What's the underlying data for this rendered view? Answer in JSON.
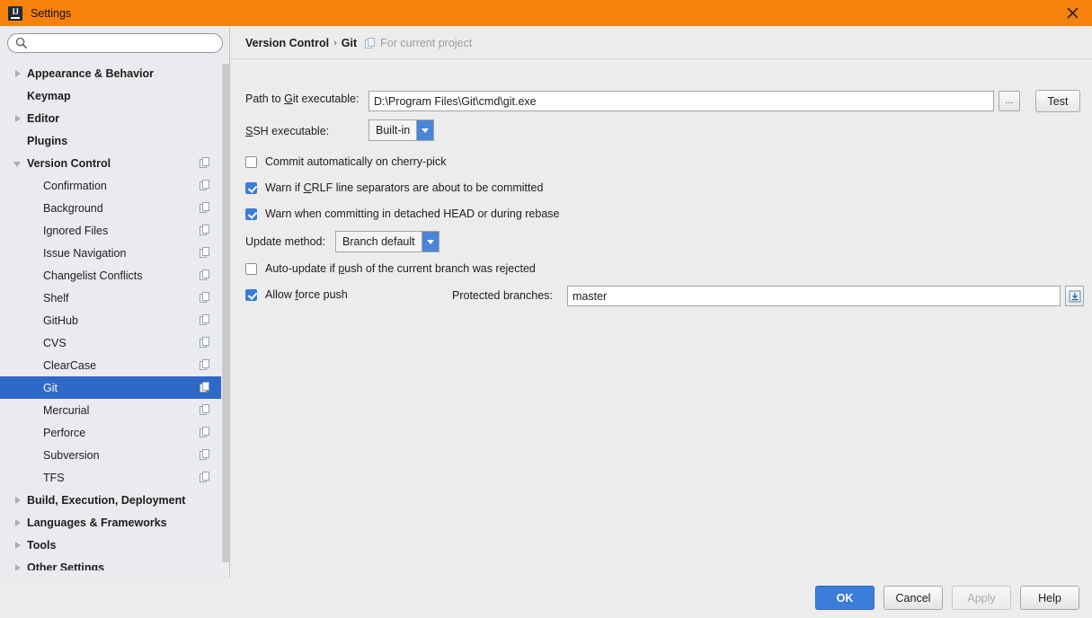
{
  "window": {
    "title": "Settings",
    "app_icon": "intellij-idea-icon",
    "close_icon": "close-icon",
    "titlebar_color": "#f7820b"
  },
  "sidebar": {
    "search": {
      "value": "",
      "placeholder": "",
      "icon": "search-icon"
    },
    "items": [
      {
        "label": "Appearance & Behavior",
        "level": 0,
        "arrow": "collapsed",
        "config_icon": false,
        "selected": false
      },
      {
        "label": "Keymap",
        "level": 0,
        "arrow": "none",
        "config_icon": false,
        "selected": false
      },
      {
        "label": "Editor",
        "level": 0,
        "arrow": "collapsed",
        "config_icon": false,
        "selected": false
      },
      {
        "label": "Plugins",
        "level": 0,
        "arrow": "none",
        "config_icon": false,
        "selected": false
      },
      {
        "label": "Version Control",
        "level": 0,
        "arrow": "expanded",
        "config_icon": true,
        "selected": false
      },
      {
        "label": "Confirmation",
        "level": 1,
        "arrow": "none",
        "config_icon": true,
        "selected": false
      },
      {
        "label": "Background",
        "level": 1,
        "arrow": "none",
        "config_icon": true,
        "selected": false
      },
      {
        "label": "Ignored Files",
        "level": 1,
        "arrow": "none",
        "config_icon": true,
        "selected": false
      },
      {
        "label": "Issue Navigation",
        "level": 1,
        "arrow": "none",
        "config_icon": true,
        "selected": false
      },
      {
        "label": "Changelist Conflicts",
        "level": 1,
        "arrow": "none",
        "config_icon": true,
        "selected": false
      },
      {
        "label": "Shelf",
        "level": 1,
        "arrow": "none",
        "config_icon": true,
        "selected": false
      },
      {
        "label": "GitHub",
        "level": 1,
        "arrow": "none",
        "config_icon": true,
        "selected": false
      },
      {
        "label": "CVS",
        "level": 1,
        "arrow": "none",
        "config_icon": true,
        "selected": false
      },
      {
        "label": "ClearCase",
        "level": 1,
        "arrow": "none",
        "config_icon": true,
        "selected": false
      },
      {
        "label": "Git",
        "level": 1,
        "arrow": "none",
        "config_icon": true,
        "selected": true
      },
      {
        "label": "Mercurial",
        "level": 1,
        "arrow": "none",
        "config_icon": true,
        "selected": false
      },
      {
        "label": "Perforce",
        "level": 1,
        "arrow": "none",
        "config_icon": true,
        "selected": false
      },
      {
        "label": "Subversion",
        "level": 1,
        "arrow": "none",
        "config_icon": true,
        "selected": false
      },
      {
        "label": "TFS",
        "level": 1,
        "arrow": "none",
        "config_icon": true,
        "selected": false
      },
      {
        "label": "Build, Execution, Deployment",
        "level": 0,
        "arrow": "collapsed",
        "config_icon": false,
        "selected": false
      },
      {
        "label": "Languages & Frameworks",
        "level": 0,
        "arrow": "collapsed",
        "config_icon": false,
        "selected": false
      },
      {
        "label": "Tools",
        "level": 0,
        "arrow": "collapsed",
        "config_icon": false,
        "selected": false
      },
      {
        "label": "Other Settings",
        "level": 0,
        "arrow": "collapsed",
        "config_icon": false,
        "selected": false
      }
    ],
    "selection_color": "#2f69c8"
  },
  "header": {
    "crumb_parent": "Version Control",
    "crumb_sep": "›",
    "crumb_current": "Git",
    "scope_icon": "project-scope-icon",
    "scope_text": "For current project"
  },
  "git_settings": {
    "path_label_pre": "Path to ",
    "path_label_mn": "G",
    "path_label_post": "it executable:",
    "path_value": "D:\\Program Files\\Git\\cmd\\git.exe",
    "browse_label": "...",
    "test_label": "Test",
    "ssh_label_mn": "S",
    "ssh_label_post": "SH executable:",
    "ssh_value": "Built-in",
    "cb_cherry_pick": {
      "label": "Commit automatically on cherry-pick",
      "checked": false
    },
    "cb_crlf_pre": "Warn if ",
    "cb_crlf_mn": "C",
    "cb_crlf_post": "RLF line separators are about to be committed",
    "cb_crlf_checked": true,
    "cb_detached": {
      "label": "Warn when committing in detached HEAD or during rebase",
      "checked": true
    },
    "update_method_label": "Update method:",
    "update_method_value": "Branch default",
    "cb_autoupdate_pre": "Auto-update if ",
    "cb_autoupdate_mn": "p",
    "cb_autoupdate_post": "ush of the current branch was rejected",
    "cb_autoupdate_checked": false,
    "cb_force_push_pre": "Allow ",
    "cb_force_push_mn": "f",
    "cb_force_push_post": "orce push",
    "cb_force_push_checked": true,
    "protected_label": "Protected branches:",
    "protected_value": "master",
    "expand_icon": "expand-editor-icon"
  },
  "footer": {
    "ok": "OK",
    "cancel": "Cancel",
    "apply": "Apply",
    "help": "Help",
    "apply_disabled": true,
    "primary_color": "#3b7dd8"
  }
}
